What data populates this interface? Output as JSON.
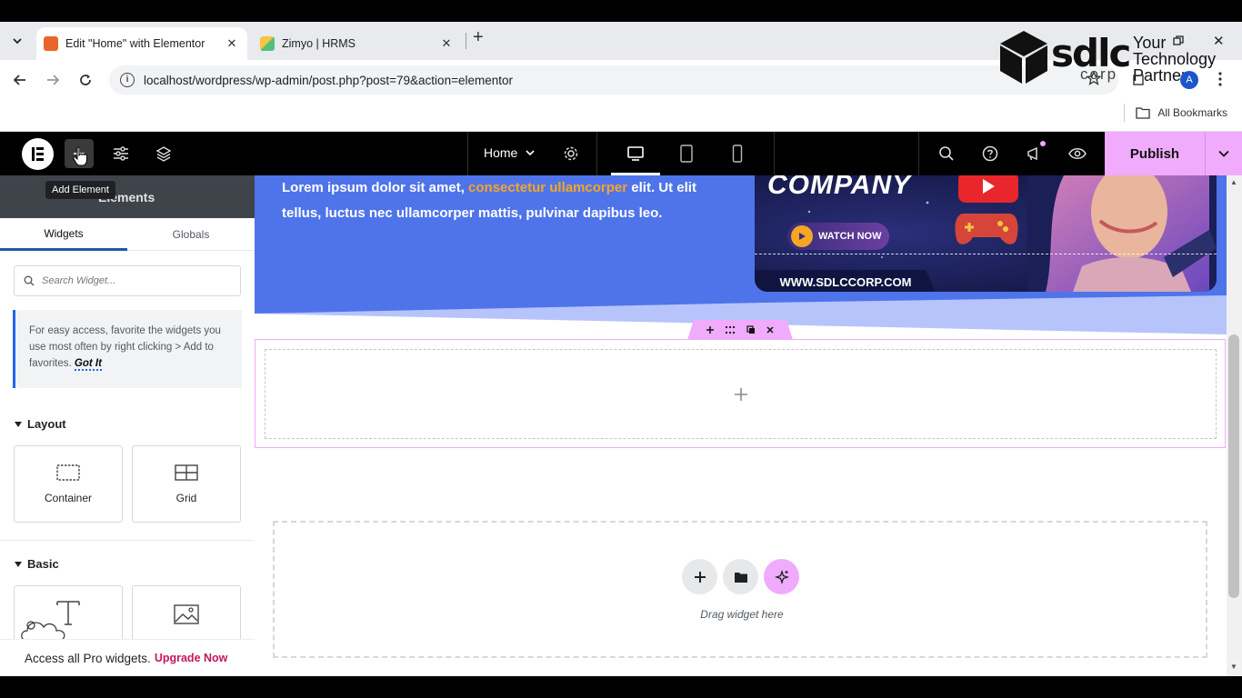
{
  "browser": {
    "tabs": [
      {
        "title": "Edit \"Home\" with Elementor",
        "favicon_color": "#e8662b",
        "active": true
      },
      {
        "title": "Zimyo | HRMS",
        "favicon_color": "#52c07a",
        "active": false
      }
    ],
    "url": "localhost/wordpress/wp-admin/post.php?post=79&action=elementor",
    "bookmarks_label": "All Bookmarks",
    "profile_initial": "A"
  },
  "watermark": {
    "brand": "sdlc",
    "sub": "corp",
    "tagline_1": "Your",
    "tagline_2": "Technology",
    "tagline_3": "Partner"
  },
  "editor_bar": {
    "page_name": "Home",
    "publish_label": "Publish",
    "accent": "#f0abfc"
  },
  "panel": {
    "header_title": "Elements",
    "tooltip": "Add Element",
    "tabs": [
      "Widgets",
      "Globals"
    ],
    "search_placeholder": "Search Widget...",
    "tip_text": "For easy access, favorite the widgets you use most often by right clicking > Add to favorites.",
    "tip_link": "Got It",
    "layout_title": "Layout",
    "layout_widgets": [
      "Container",
      "Grid"
    ],
    "basic_title": "Basic",
    "promo_text": "Access all Pro widgets.",
    "promo_link": "Upgrade Now"
  },
  "canvas": {
    "hero_text_before": "Lorem ipsum dolor sit amet, ",
    "hero_text_highlight": "consectetur ullamcorper",
    "hero_text_after": " elit. Ut elit tellus, luctus nec ullamcorper mattis, pulvinar dapibus leo.",
    "banner_company": "COMPANY",
    "banner_watch": "WATCH NOW",
    "banner_site": "WWW.SDLCCORP.COM",
    "drop_text": "Drag widget here",
    "hero_color": "#4f74ea",
    "highlight_color": "#f6a623"
  }
}
